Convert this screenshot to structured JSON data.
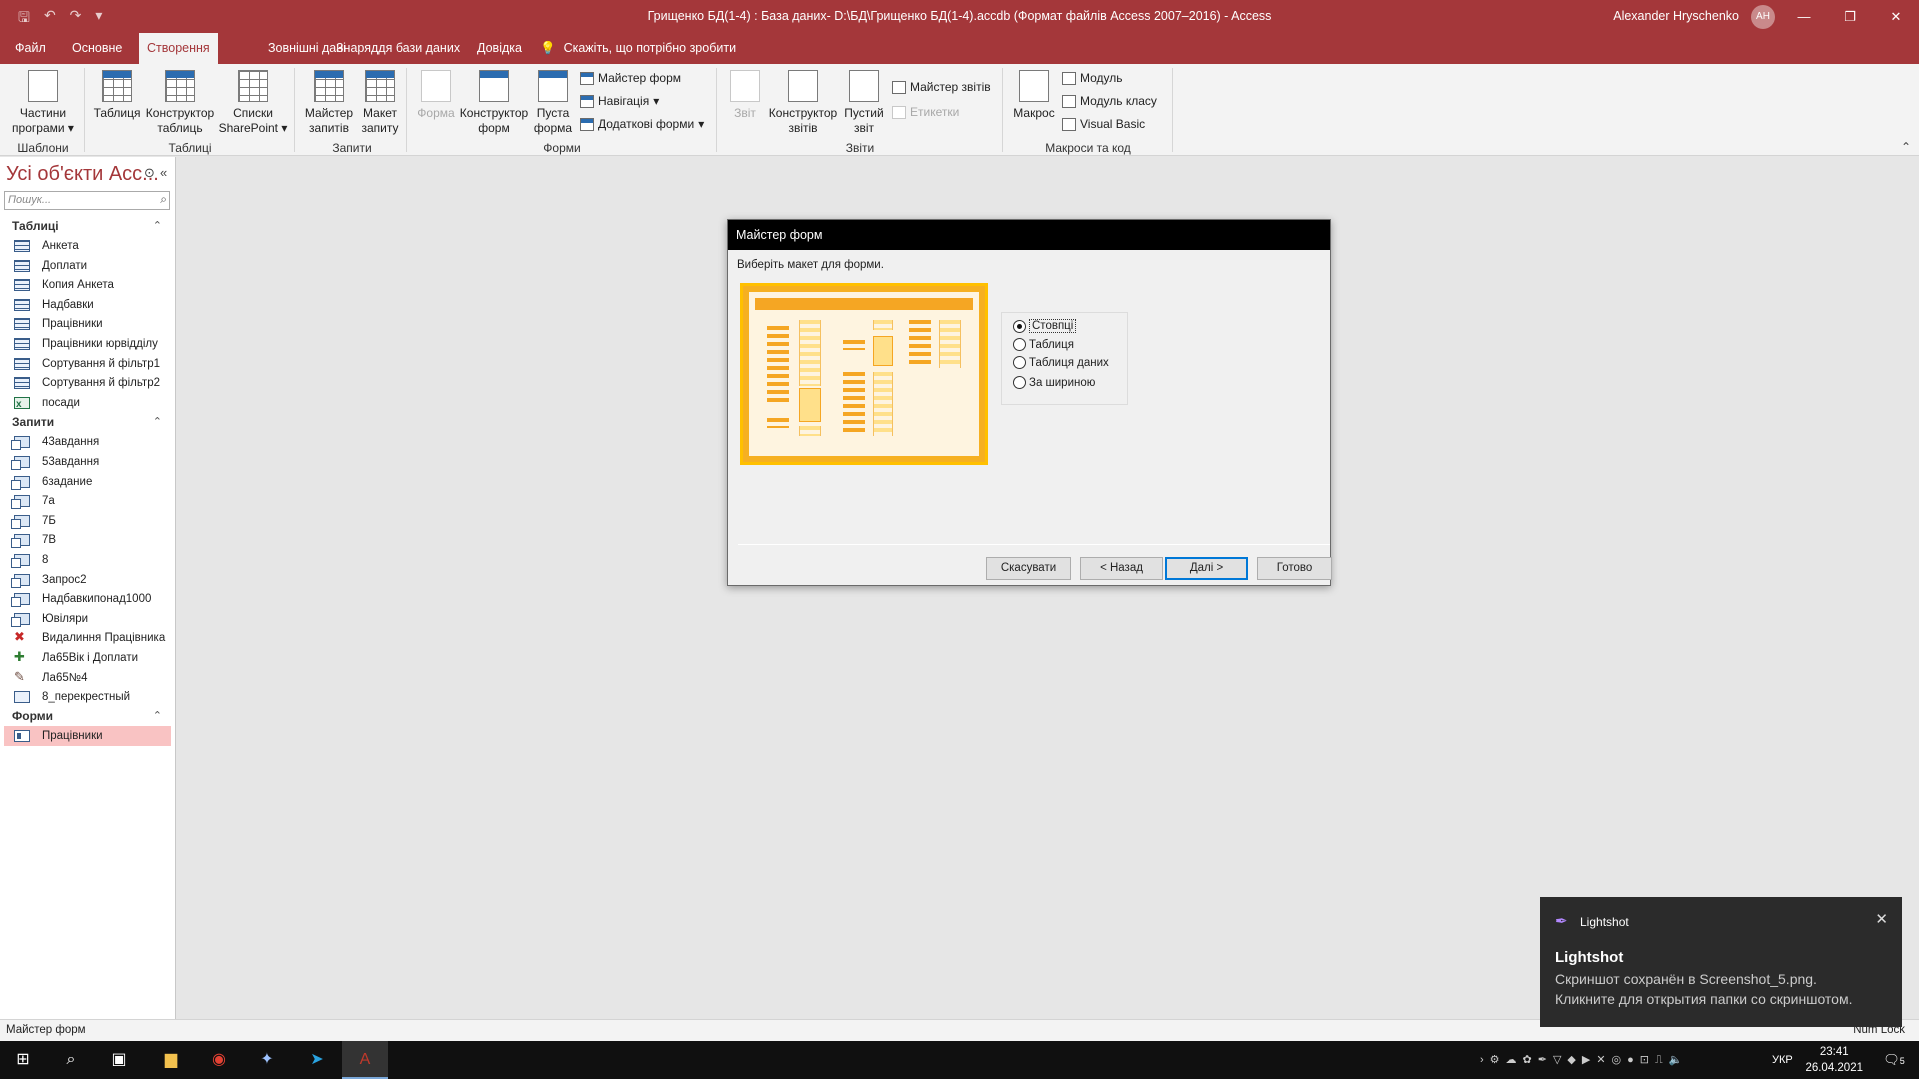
{
  "window": {
    "title": "Грищенко БД(1-4) : База даних- D:\\БД\\Грищенко БД(1-4).accdb (Формат файлів Access 2007–2016)  -  Access",
    "user": "Alexander Hryschenko",
    "user_initials": "AH",
    "accent_color": "#a4373a"
  },
  "tabs": [
    {
      "label": "Файл"
    },
    {
      "label": "Основне"
    },
    {
      "label": "Створення"
    },
    {
      "label": "Зовнішні дані"
    },
    {
      "label": "Знаряддя бази даних"
    },
    {
      "label": "Довідка"
    },
    {
      "label": "Скажіть, що потрібно зробити"
    }
  ],
  "ribbon": {
    "templates": {
      "parts": "Частини програми",
      "group": "Шаблони"
    },
    "tables": {
      "table": "Таблиця",
      "designer": "Конструктор таблиць",
      "sharepoint": "Списки SharePoint",
      "group": "Таблиці"
    },
    "queries": {
      "wizard": "Майстер запитів",
      "design": "Макет запиту",
      "group": "Запити"
    },
    "forms": {
      "form": "Форма",
      "designer": "Конструктор форм",
      "blank": "Пуста форма",
      "wizard": "Майстер форм",
      "navigation": "Навігація",
      "more": "Додаткові форми",
      "group": "Форми"
    },
    "reports": {
      "report": "Звіт",
      "designer": "Конструктор звітів",
      "blank": "Пустий звіт",
      "wizard": "Майстер звітів",
      "labels": "Етикетки",
      "group": "Звіти"
    },
    "macros": {
      "macro": "Макрос",
      "module": "Модуль",
      "class_module": "Модуль класу",
      "vb": "Visual Basic",
      "group": "Макроси та код"
    }
  },
  "nav": {
    "title": "Усі об'єкти Acc...",
    "search_placeholder": "Пошук...",
    "sections": {
      "tables": "Таблиці",
      "queries": "Запити",
      "forms": "Форми"
    },
    "tables": [
      "Анкета",
      "Доплати",
      "Копия Анкета",
      "Надбавки",
      "Працівники",
      "Працівники юрвідділу",
      "Сортування й фільтр1",
      "Сортування й фільтр2",
      "посади"
    ],
    "queries": [
      "43авдання",
      "53авдання",
      "6задание",
      "7а",
      "7Б",
      "7В",
      "8",
      "Запрос2",
      "Надбавкипонад1000",
      "Ювіляри",
      "Видалиння Працівника",
      "Ла65Вік і Доплати",
      "Ла65№4",
      "8_перекрестный"
    ],
    "forms": [
      "Працівники"
    ],
    "selected_form": "Працівники"
  },
  "dialog": {
    "title": "Майстер форм",
    "prompt": "Виберіть макет для форми.",
    "options": [
      {
        "label": "Стовпці",
        "checked": true
      },
      {
        "label": "Таблиця",
        "checked": false
      },
      {
        "label": "Таблиця даних",
        "checked": false
      },
      {
        "label": "За шириною",
        "checked": false
      }
    ],
    "buttons": {
      "cancel": "Скасувати",
      "back": "< Назад",
      "next": "Далі >",
      "finish": "Готово"
    }
  },
  "status": {
    "left": "Майстер форм",
    "right": "Num Lock"
  },
  "toast": {
    "app": "Lightshot",
    "title": "Lightshot",
    "line1": "Скриншот сохранён в Screenshot_5.png.",
    "line2": "Кликните для открытия папки со скриншотом."
  },
  "taskbar": {
    "lang": "УКР",
    "time": "23:41",
    "date": "26.04.2021",
    "notifications": "5"
  }
}
